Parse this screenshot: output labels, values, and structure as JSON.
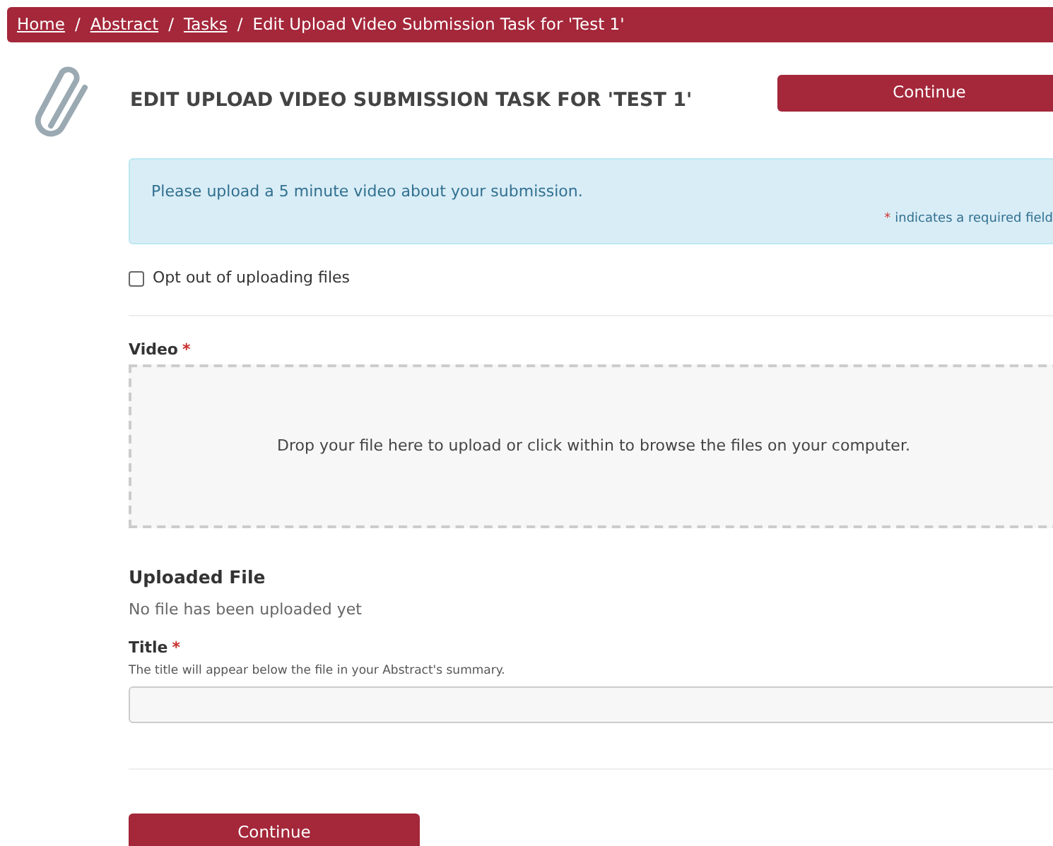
{
  "breadcrumbs": [
    {
      "label": "Home",
      "kind": "link"
    },
    {
      "label": "Abstract",
      "kind": "link"
    },
    {
      "label": "Tasks",
      "kind": "link"
    },
    {
      "label": "Edit Upload Video Submission Task for 'Test 1'",
      "kind": "current"
    }
  ],
  "breadcrumb_separator": "/",
  "page_title": "EDIT UPLOAD VIDEO SUBMISSION TASK FOR 'TEST 1'",
  "top_button": "Continue",
  "info": {
    "message": "Please upload a 5 minute video about your submission.",
    "required_mark": "*",
    "required_note": "indicates a required field"
  },
  "opt_out": {
    "label": "Opt out of uploading files",
    "checked": false
  },
  "video": {
    "label": "Video",
    "required_mark": "*",
    "dropzone": "Drop your file here to upload or click within to browse the files on your computer."
  },
  "uploaded_file": {
    "heading": "Uploaded File",
    "status": "No file has been uploaded yet"
  },
  "title_field": {
    "label": "Title",
    "required_mark": "*",
    "hint": "The title will appear below the file in your Abstract's summary."
  },
  "bottom_button": "Continue"
}
